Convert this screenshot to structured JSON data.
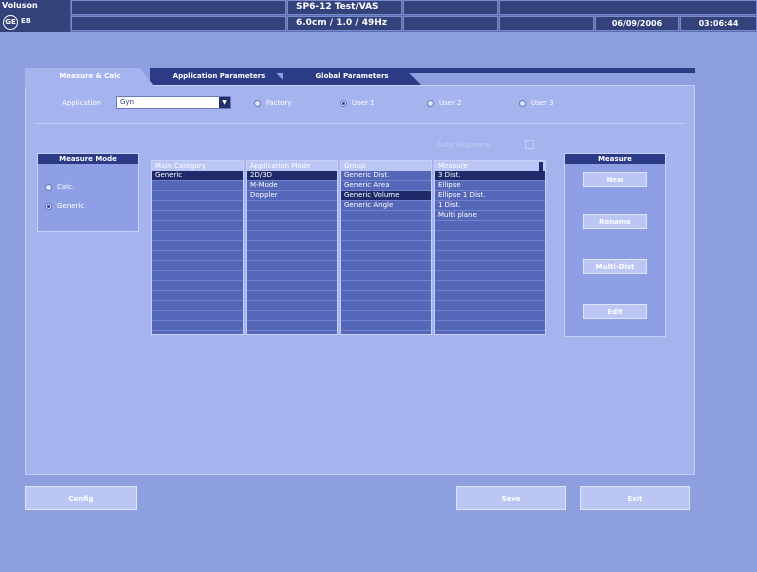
{
  "header": {
    "brand": "Voluson",
    "probe_indicator": "E8",
    "title": "SP6-12 Test/VAS",
    "params": "6.0cm / 1.0 / 49Hz",
    "date": "06/09/2006",
    "time": "03:06:44"
  },
  "tabs": [
    {
      "label": "Measure & Calc",
      "active": true
    },
    {
      "label": "Application Parameters",
      "active": false
    },
    {
      "label": "Global Parameters",
      "active": false
    }
  ],
  "application": {
    "label": "Application",
    "selected": "Gyn",
    "radios": [
      {
        "label": "Factory",
        "checked": false
      },
      {
        "label": "User 1",
        "checked": true
      },
      {
        "label": "User 2",
        "checked": false
      },
      {
        "label": "User 3",
        "checked": false
      }
    ]
  },
  "measure_mode": {
    "title": "Measure Mode",
    "options": [
      {
        "label": "Calc.",
        "checked": false
      },
      {
        "label": "Generic",
        "checked": true
      }
    ]
  },
  "auto_sequence": {
    "label": "Auto Sequence",
    "checked": false
  },
  "columns": [
    {
      "header": "Main Category",
      "items": [
        "Generic"
      ],
      "selected": 0
    },
    {
      "header": "Application Mode",
      "items": [
        "2D/3D",
        "M-Mode",
        "Doppler"
      ],
      "selected": 0
    },
    {
      "header": "Group",
      "items": [
        "Generic Dist.",
        "Generic Area",
        "Generic Volume",
        "Generic Angle"
      ],
      "selected": 2
    },
    {
      "header": "Measure",
      "items": [
        "3 Dist.",
        "Ellipse",
        "Ellipse 1 Dist.",
        "1 Dist.",
        "Multi plane"
      ],
      "selected": 0
    }
  ],
  "measure_panel": {
    "title": "Measure",
    "buttons": [
      "New",
      "Rename",
      "Multi-Dist",
      "Edit"
    ]
  },
  "footer": {
    "left_button": "Config",
    "save_button": "Save",
    "exit_button": "Exit"
  },
  "colors": {
    "background": "#8e9fe0",
    "panel": "#a5b3ef",
    "dark_accent": "#2b3b86",
    "selection": "#1e2a6a"
  }
}
